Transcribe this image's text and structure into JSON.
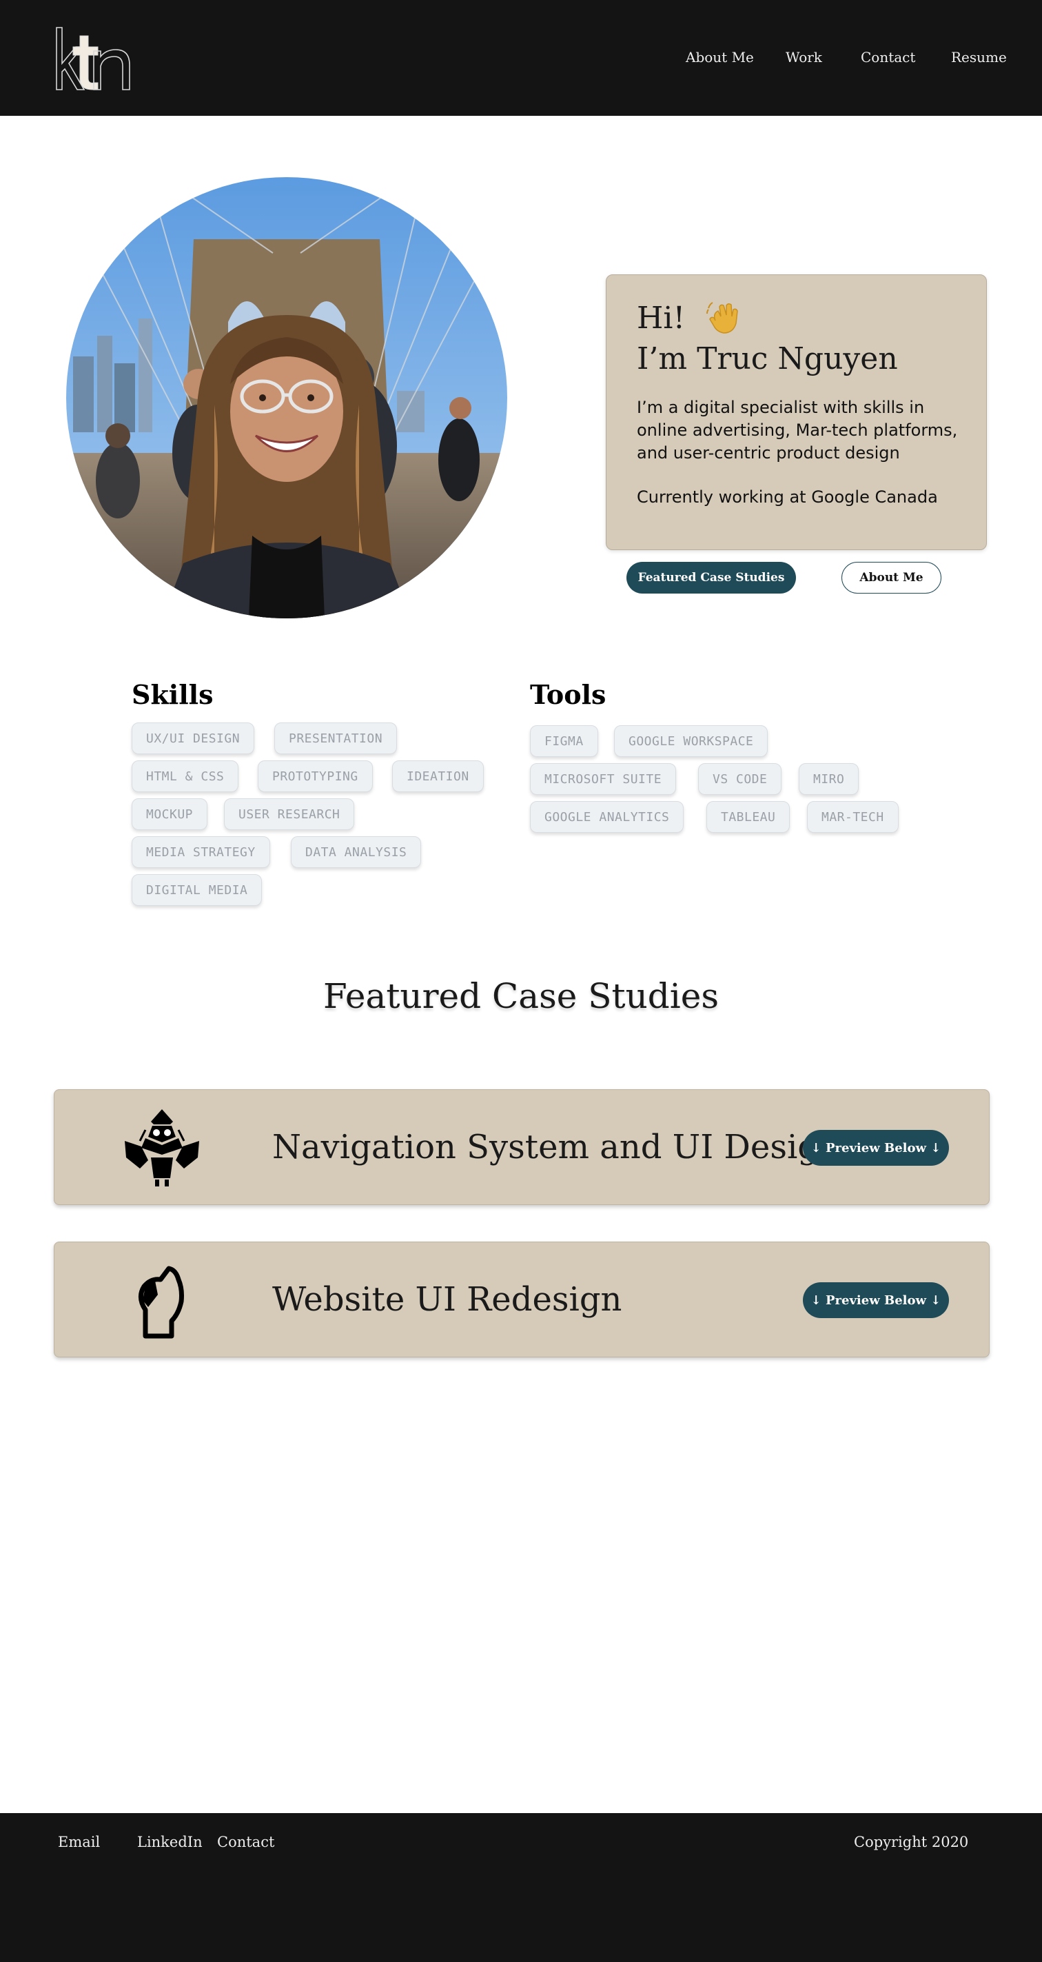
{
  "header": {
    "logo_text": "ktn",
    "nav": [
      "About Me",
      "Work",
      "Contact",
      "Resume"
    ]
  },
  "hero": {
    "greeting": "Hi!",
    "name": "I’m Truc Nguyen",
    "bio": "I’m a digital specialist with skills in online advertising, Mar-tech platforms, and user-centric product design",
    "current": "Currently working at Google Canada",
    "primary_button": "Featured Case Studies",
    "secondary_button": "About Me",
    "icons": {
      "greeting": "waving-hand-icon"
    }
  },
  "skills": {
    "title": "Skills",
    "items": [
      "UX/UI DESIGN",
      "PRESENTATION",
      "HTML & CSS",
      "PROTOTYPING",
      "IDEATION",
      "MOCKUP",
      "USER RESEARCH",
      "MEDIA STRATEGY",
      "DATA ANALYSIS",
      "DIGITAL MEDIA"
    ]
  },
  "tools": {
    "title": "Tools",
    "items": [
      "FIGMA",
      "GOOGLE WORKSPACE",
      "MICROSOFT SUITE",
      "VS CODE",
      "MIRO",
      "GOOGLE ANALYTICS",
      "TABLEAU",
      "MAR-TECH"
    ]
  },
  "featured": {
    "title": "Featured Case Studies",
    "cases": [
      {
        "title": "Navigation System and UI Design",
        "button": "↓ Preview Below ↓",
        "icon": "starfighter-icon"
      },
      {
        "title": "Website UI Redesign",
        "button": "↓ Preview Below ↓",
        "icon": "chess-knight-icon"
      }
    ]
  },
  "footer": {
    "links": [
      "Email",
      "LinkedIn",
      "Contact"
    ],
    "copyright": "Copyright 2020"
  },
  "colors": {
    "header_bg": "#141414",
    "card_beige": "#d6cbb9",
    "accent_teal": "#1f4b59",
    "tag_bg": "#eef1f4",
    "tag_text": "#9aa0a7"
  }
}
